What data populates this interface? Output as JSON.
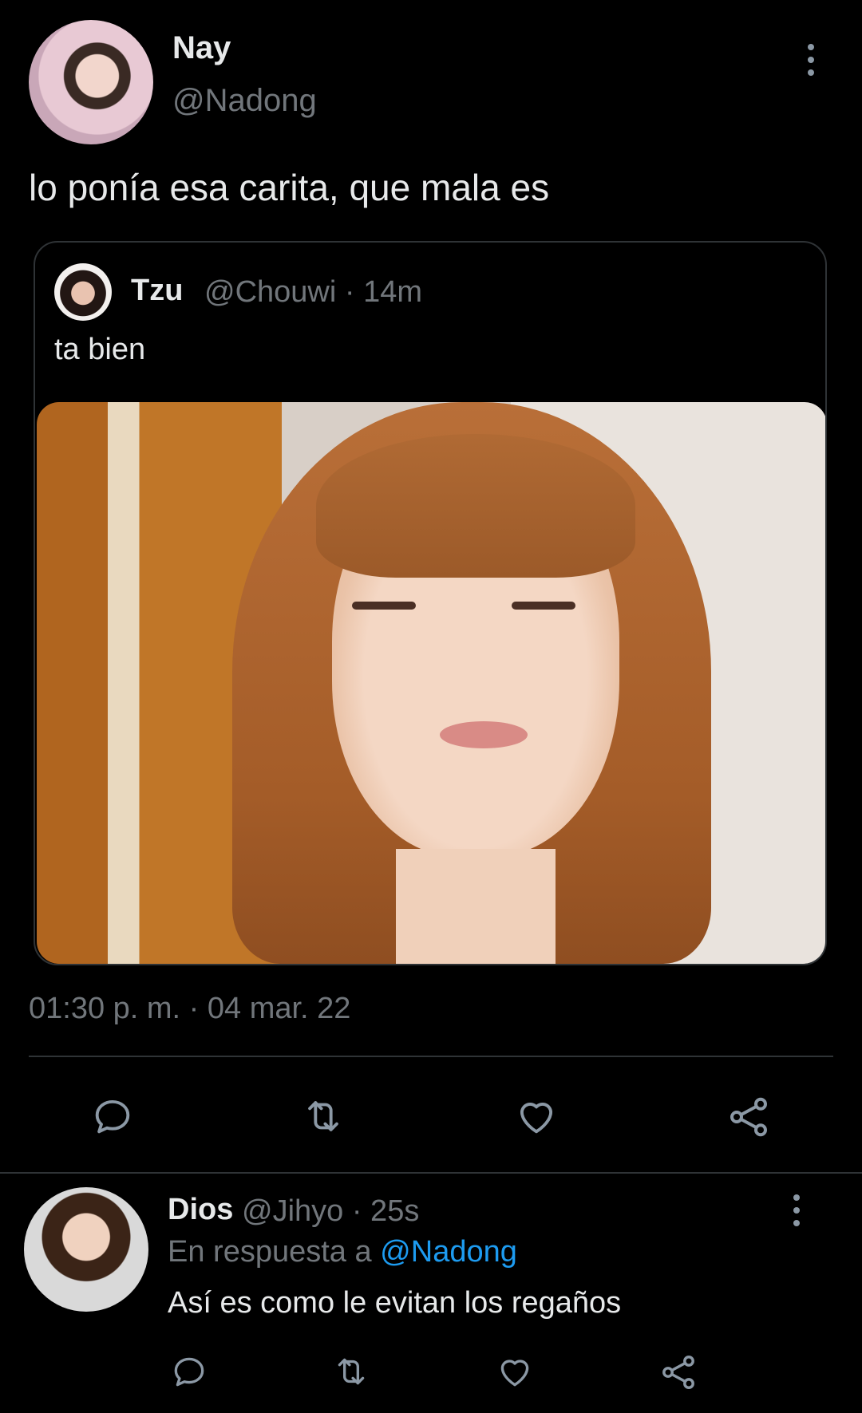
{
  "tweet": {
    "author_name": "Nay",
    "author_handle": "@Nadong",
    "text": "lo ponía esa carita, que mala es",
    "timestamp": "01:30 p. m. · 04 mar. 22"
  },
  "quote": {
    "author_name": "Tzu",
    "author_handle_time": "@Chouwi · 14m",
    "text": "ta bien"
  },
  "actions": [
    "reply-icon",
    "retweet-icon",
    "like-icon",
    "share-icon"
  ],
  "reply": {
    "author_name": "Dios",
    "author_handle_time": "@Jihyo · 25s",
    "reply_to_prefix": "En respuesta a",
    "reply_to_handle": "@Nadong",
    "text": "Así es como le evitan los regaños"
  },
  "colors": {
    "background": "#000000",
    "text": "#e7e9ea",
    "muted": "#71767b",
    "link": "#1d9bf0",
    "border": "#2f3336"
  }
}
